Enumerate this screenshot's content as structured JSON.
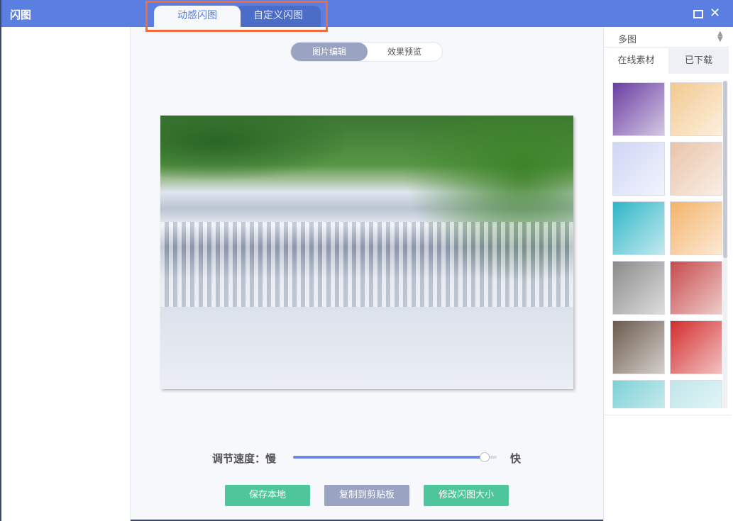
{
  "app": {
    "title": "闪图"
  },
  "top_tabs": [
    {
      "label": "动感闪图",
      "active": true
    },
    {
      "label": "自定义闪图",
      "active": false
    }
  ],
  "segment": [
    {
      "label": "图片编辑",
      "active": true
    },
    {
      "label": "效果预览",
      "active": false
    }
  ],
  "speed": {
    "label": "调节速度：慢",
    "fast_label": "快",
    "value_fraction": 0.94
  },
  "buttons": {
    "save": "保存本地",
    "copy": "复制到剪贴板",
    "resize": "修改闪图大小"
  },
  "right_panel": {
    "select_value": "多图",
    "tabs": [
      {
        "label": "在线素材",
        "active": true
      },
      {
        "label": "已下载",
        "active": false
      }
    ],
    "thumbnails": [
      {
        "name": "love-galaxy",
        "color": "#6a3ea1"
      },
      {
        "name": "cartoon-collage",
        "color": "#f3c98f"
      },
      {
        "name": "bubbles-car",
        "color": "#cfd6f5"
      },
      {
        "name": "girl-portrait",
        "color": "#e9c4a8"
      },
      {
        "name": "duck-cartoon",
        "color": "#2fb6c7"
      },
      {
        "name": "green-leaf-sunburst",
        "color": "#f4b36b"
      },
      {
        "name": "two-people-photo",
        "color": "#8a8a8a"
      },
      {
        "name": "group-colorful",
        "color": "#c74a4a"
      },
      {
        "name": "girl-dark-portrait",
        "color": "#6b5a4d"
      },
      {
        "name": "purple-monsters",
        "color": "#d42c2c"
      },
      {
        "name": "penguin-cartoon",
        "color": "#7ed1d6"
      },
      {
        "name": "striped-pattern",
        "color": "#bfe6ea"
      }
    ]
  }
}
